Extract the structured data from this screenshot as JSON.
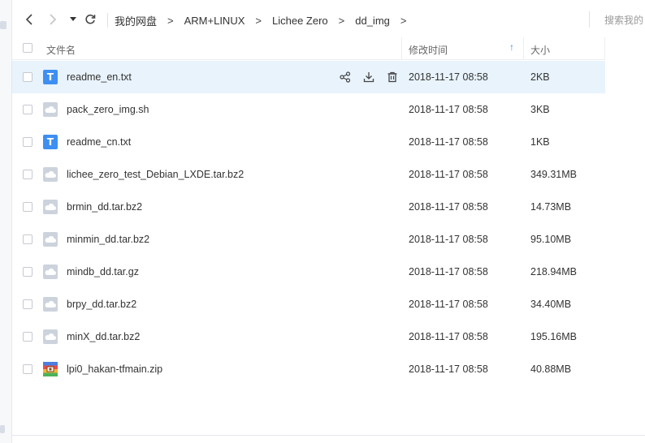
{
  "nav": {
    "back_icon": "chevron-left-icon",
    "forward_icon": "chevron-right-icon",
    "history_icon": "caret-down-icon",
    "refresh_icon": "refresh-icon"
  },
  "breadcrumb": {
    "items": [
      "我的网盘",
      "ARM+LINUX",
      "Lichee Zero",
      "dd_img"
    ],
    "separator": ">"
  },
  "search": {
    "placeholder": "搜索我的"
  },
  "table": {
    "headers": {
      "name": "文件名",
      "modified": "修改时间",
      "size": "大小"
    },
    "sort_indicator": "↑",
    "hover_actions": [
      "share-icon",
      "download-icon",
      "delete-icon"
    ],
    "files": [
      {
        "name": "readme_en.txt",
        "type": "txt",
        "modified": "2018-11-17 08:58",
        "size": "2KB"
      },
      {
        "name": "pack_zero_img.sh",
        "type": "other",
        "modified": "2018-11-17 08:58",
        "size": "3KB"
      },
      {
        "name": "readme_cn.txt",
        "type": "txt",
        "modified": "2018-11-17 08:58",
        "size": "1KB"
      },
      {
        "name": "lichee_zero_test_Debian_LXDE.tar.bz2",
        "type": "other",
        "modified": "2018-11-17 08:58",
        "size": "349.31MB"
      },
      {
        "name": "brmin_dd.tar.bz2",
        "type": "other",
        "modified": "2018-11-17 08:58",
        "size": "14.73MB"
      },
      {
        "name": "minmin_dd.tar.bz2",
        "type": "other",
        "modified": "2018-11-17 08:58",
        "size": "95.10MB"
      },
      {
        "name": "mindb_dd.tar.gz",
        "type": "other",
        "modified": "2018-11-17 08:58",
        "size": "218.94MB"
      },
      {
        "name": "brpy_dd.tar.bz2",
        "type": "other",
        "modified": "2018-11-17 08:58",
        "size": "34.40MB"
      },
      {
        "name": "minX_dd.tar.bz2",
        "type": "other",
        "modified": "2018-11-17 08:58",
        "size": "195.16MB"
      },
      {
        "name": "lpi0_hakan-tfmain.zip",
        "type": "zip",
        "modified": "2018-11-17 08:58",
        "size": "40.88MB"
      }
    ]
  },
  "colors": {
    "accent": "#3a8ee6",
    "hover_row": "#e8f3fc",
    "txt_icon": "#3d8ff2",
    "generic_icon": "#ccd3dd"
  }
}
